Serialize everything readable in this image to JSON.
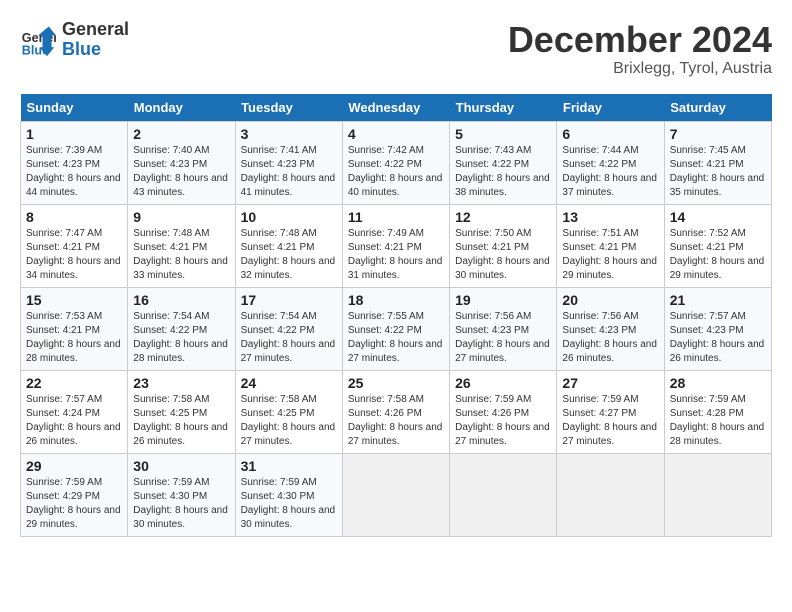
{
  "header": {
    "logo_line1": "General",
    "logo_line2": "Blue",
    "month": "December 2024",
    "location": "Brixlegg, Tyrol, Austria"
  },
  "days_of_week": [
    "Sunday",
    "Monday",
    "Tuesday",
    "Wednesday",
    "Thursday",
    "Friday",
    "Saturday"
  ],
  "weeks": [
    [
      {
        "date": "1",
        "sunrise": "Sunrise: 7:39 AM",
        "sunset": "Sunset: 4:23 PM",
        "daylight": "Daylight: 8 hours and 44 minutes."
      },
      {
        "date": "2",
        "sunrise": "Sunrise: 7:40 AM",
        "sunset": "Sunset: 4:23 PM",
        "daylight": "Daylight: 8 hours and 43 minutes."
      },
      {
        "date": "3",
        "sunrise": "Sunrise: 7:41 AM",
        "sunset": "Sunset: 4:23 PM",
        "daylight": "Daylight: 8 hours and 41 minutes."
      },
      {
        "date": "4",
        "sunrise": "Sunrise: 7:42 AM",
        "sunset": "Sunset: 4:22 PM",
        "daylight": "Daylight: 8 hours and 40 minutes."
      },
      {
        "date": "5",
        "sunrise": "Sunrise: 7:43 AM",
        "sunset": "Sunset: 4:22 PM",
        "daylight": "Daylight: 8 hours and 38 minutes."
      },
      {
        "date": "6",
        "sunrise": "Sunrise: 7:44 AM",
        "sunset": "Sunset: 4:22 PM",
        "daylight": "Daylight: 8 hours and 37 minutes."
      },
      {
        "date": "7",
        "sunrise": "Sunrise: 7:45 AM",
        "sunset": "Sunset: 4:21 PM",
        "daylight": "Daylight: 8 hours and 35 minutes."
      }
    ],
    [
      {
        "date": "8",
        "sunrise": "Sunrise: 7:47 AM",
        "sunset": "Sunset: 4:21 PM",
        "daylight": "Daylight: 8 hours and 34 minutes."
      },
      {
        "date": "9",
        "sunrise": "Sunrise: 7:48 AM",
        "sunset": "Sunset: 4:21 PM",
        "daylight": "Daylight: 8 hours and 33 minutes."
      },
      {
        "date": "10",
        "sunrise": "Sunrise: 7:48 AM",
        "sunset": "Sunset: 4:21 PM",
        "daylight": "Daylight: 8 hours and 32 minutes."
      },
      {
        "date": "11",
        "sunrise": "Sunrise: 7:49 AM",
        "sunset": "Sunset: 4:21 PM",
        "daylight": "Daylight: 8 hours and 31 minutes."
      },
      {
        "date": "12",
        "sunrise": "Sunrise: 7:50 AM",
        "sunset": "Sunset: 4:21 PM",
        "daylight": "Daylight: 8 hours and 30 minutes."
      },
      {
        "date": "13",
        "sunrise": "Sunrise: 7:51 AM",
        "sunset": "Sunset: 4:21 PM",
        "daylight": "Daylight: 8 hours and 29 minutes."
      },
      {
        "date": "14",
        "sunrise": "Sunrise: 7:52 AM",
        "sunset": "Sunset: 4:21 PM",
        "daylight": "Daylight: 8 hours and 29 minutes."
      }
    ],
    [
      {
        "date": "15",
        "sunrise": "Sunrise: 7:53 AM",
        "sunset": "Sunset: 4:21 PM",
        "daylight": "Daylight: 8 hours and 28 minutes."
      },
      {
        "date": "16",
        "sunrise": "Sunrise: 7:54 AM",
        "sunset": "Sunset: 4:22 PM",
        "daylight": "Daylight: 8 hours and 28 minutes."
      },
      {
        "date": "17",
        "sunrise": "Sunrise: 7:54 AM",
        "sunset": "Sunset: 4:22 PM",
        "daylight": "Daylight: 8 hours and 27 minutes."
      },
      {
        "date": "18",
        "sunrise": "Sunrise: 7:55 AM",
        "sunset": "Sunset: 4:22 PM",
        "daylight": "Daylight: 8 hours and 27 minutes."
      },
      {
        "date": "19",
        "sunrise": "Sunrise: 7:56 AM",
        "sunset": "Sunset: 4:23 PM",
        "daylight": "Daylight: 8 hours and 27 minutes."
      },
      {
        "date": "20",
        "sunrise": "Sunrise: 7:56 AM",
        "sunset": "Sunset: 4:23 PM",
        "daylight": "Daylight: 8 hours and 26 minutes."
      },
      {
        "date": "21",
        "sunrise": "Sunrise: 7:57 AM",
        "sunset": "Sunset: 4:23 PM",
        "daylight": "Daylight: 8 hours and 26 minutes."
      }
    ],
    [
      {
        "date": "22",
        "sunrise": "Sunrise: 7:57 AM",
        "sunset": "Sunset: 4:24 PM",
        "daylight": "Daylight: 8 hours and 26 minutes."
      },
      {
        "date": "23",
        "sunrise": "Sunrise: 7:58 AM",
        "sunset": "Sunset: 4:25 PM",
        "daylight": "Daylight: 8 hours and 26 minutes."
      },
      {
        "date": "24",
        "sunrise": "Sunrise: 7:58 AM",
        "sunset": "Sunset: 4:25 PM",
        "daylight": "Daylight: 8 hours and 27 minutes."
      },
      {
        "date": "25",
        "sunrise": "Sunrise: 7:58 AM",
        "sunset": "Sunset: 4:26 PM",
        "daylight": "Daylight: 8 hours and 27 minutes."
      },
      {
        "date": "26",
        "sunrise": "Sunrise: 7:59 AM",
        "sunset": "Sunset: 4:26 PM",
        "daylight": "Daylight: 8 hours and 27 minutes."
      },
      {
        "date": "27",
        "sunrise": "Sunrise: 7:59 AM",
        "sunset": "Sunset: 4:27 PM",
        "daylight": "Daylight: 8 hours and 27 minutes."
      },
      {
        "date": "28",
        "sunrise": "Sunrise: 7:59 AM",
        "sunset": "Sunset: 4:28 PM",
        "daylight": "Daylight: 8 hours and 28 minutes."
      }
    ],
    [
      {
        "date": "29",
        "sunrise": "Sunrise: 7:59 AM",
        "sunset": "Sunset: 4:29 PM",
        "daylight": "Daylight: 8 hours and 29 minutes."
      },
      {
        "date": "30",
        "sunrise": "Sunrise: 7:59 AM",
        "sunset": "Sunset: 4:30 PM",
        "daylight": "Daylight: 8 hours and 30 minutes."
      },
      {
        "date": "31",
        "sunrise": "Sunrise: 7:59 AM",
        "sunset": "Sunset: 4:30 PM",
        "daylight": "Daylight: 8 hours and 30 minutes."
      },
      null,
      null,
      null,
      null
    ]
  ]
}
